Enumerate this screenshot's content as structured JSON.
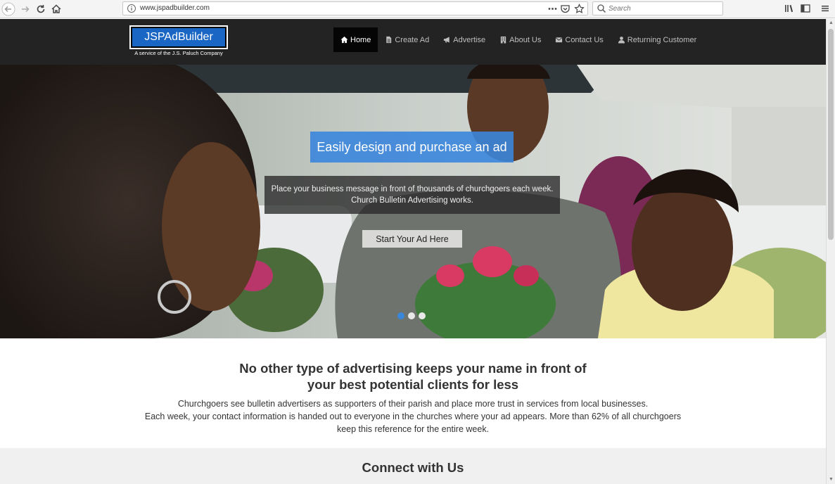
{
  "browser": {
    "url": "www.jspadbuilder.com",
    "search_placeholder": "Search"
  },
  "site": {
    "logo_text": "JSPAdBuilder",
    "logo_tagline": "A service of the J.S. Paluch Company",
    "nav": [
      {
        "label": "Home",
        "icon": "home-icon"
      },
      {
        "label": "Create Ad",
        "icon": "document-icon"
      },
      {
        "label": "Advertise",
        "icon": "megaphone-icon"
      },
      {
        "label": "About Us",
        "icon": "building-icon"
      },
      {
        "label": "Contact Us",
        "icon": "envelope-icon"
      },
      {
        "label": "Returning Customer",
        "icon": "user-icon"
      }
    ],
    "active_nav": "Home"
  },
  "hero": {
    "title": "Easily design and purchase an ad",
    "message_line1": "Place your business message in front of thousands of churchgoers each week.",
    "message_line2": "Church Bulletin Advertising works.",
    "cta": "Start Your Ad Here",
    "slides": 3,
    "active_slide": 1
  },
  "pitch": {
    "heading_line1": "No other type of advertising keeps your name in front of",
    "heading_line2": "your best potential clients for less",
    "body_line1": "Churchgoers see bulletin advertisers as supporters of their parish and place more trust in services from local businesses.",
    "body_line2": "Each week, your contact information is handed out to everyone in the churches where your ad appears. More than 62% of all churchgoers",
    "body_line3": "keep this reference for the entire week."
  },
  "connect": {
    "heading": "Connect with Us"
  },
  "colors": {
    "header_bg": "#232323",
    "accent_blue": "#3b86db",
    "logo_blue": "#1a66c4"
  }
}
